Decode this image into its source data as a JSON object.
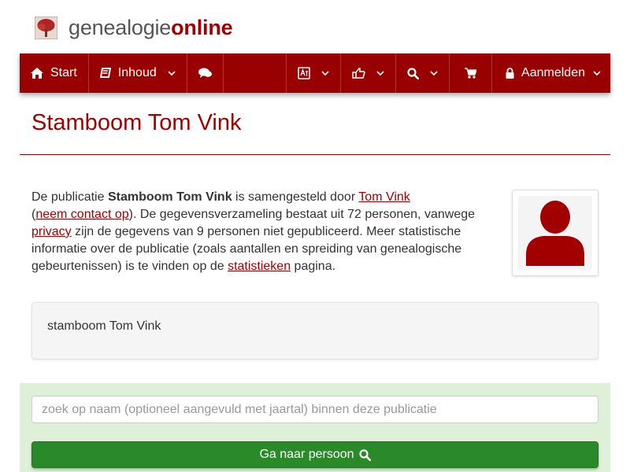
{
  "brand": {
    "part1": "genealogie",
    "part2": "online",
    "brand_color": "#a20000"
  },
  "navbar": {
    "background": "#990000",
    "start_label": "Start",
    "inhoud_label": "Inhoud",
    "aanmelden_label": "Aanmelden",
    "icons": [
      "home-icon",
      "book-icon",
      "comments-icon",
      "language-icon",
      "thumbs-up-icon",
      "search-icon",
      "cart-icon",
      "lock-icon"
    ]
  },
  "page": {
    "title": "Stamboom Tom Vink"
  },
  "intro": {
    "t1": "De publicatie ",
    "pub_name": "Stamboom Tom Vink",
    "t2": " is samengesteld door ",
    "author_link": "Tom Vink",
    "t3": " (",
    "contact_link": "neem contact op",
    "t4": "). De gegevensverzameling bestaat uit 72 personen, vanwege ",
    "privacy_link": "privacy",
    "t5": " zijn de gegevens van 9 personen niet gepubliceerd. Meer statistische informatie over de publicatie (zoals aantallen en spreiding van genealogische gebeurtenissen) is te vinden op de ",
    "stats_link": "statistieken",
    "t6": " pagina."
  },
  "description": "stamboom Tom Vink",
  "search": {
    "placeholder": "zoek op naam (optioneel aangevuld met jaartal) binnen deze publicatie",
    "value": "",
    "button_label": "Ga naar persoon"
  },
  "colors": {
    "accent": "#a20000",
    "panel_green": "#dff0d8",
    "button_green": "#2a8a2a",
    "avatar": "#a20000"
  }
}
